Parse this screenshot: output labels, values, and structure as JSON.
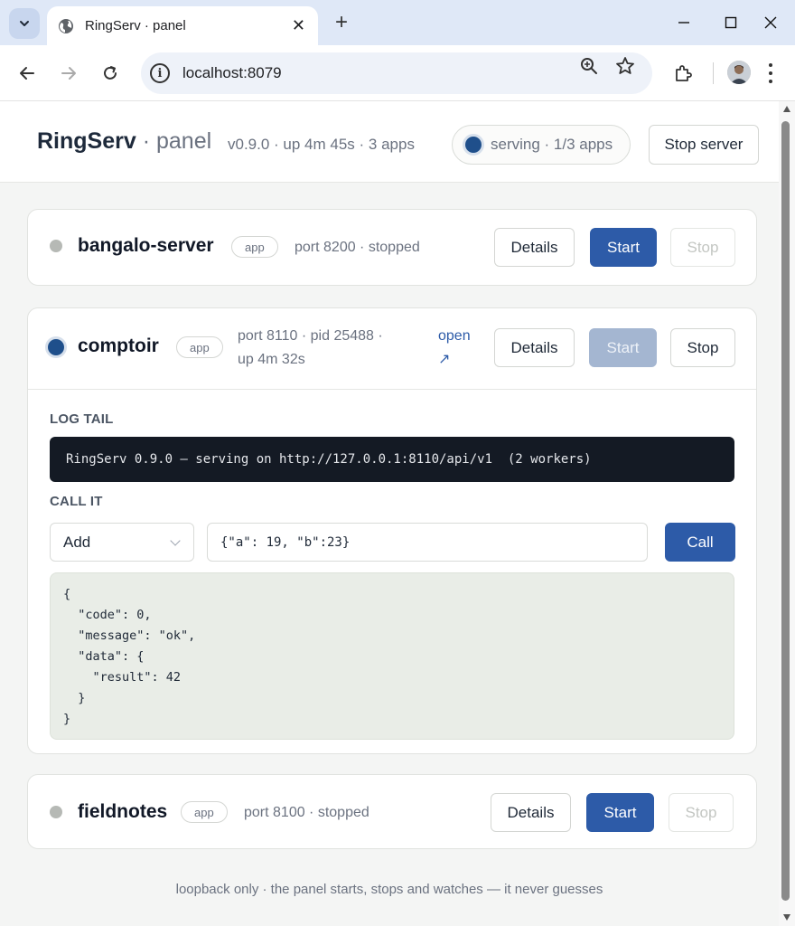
{
  "browser": {
    "tab_title": "RingServ · panel",
    "url": "localhost:8079"
  },
  "header": {
    "brand": "RingServ",
    "separator": "·",
    "subtitle": "panel",
    "meta": "v0.9.0 · up 4m 45s · 3 apps",
    "status": "serving · 1/3 apps",
    "stop_server_label": "Stop server"
  },
  "apps": [
    {
      "name": "bangalo-server",
      "tag": "app",
      "meta": "port 8200 · stopped",
      "running": false,
      "details_label": "Details",
      "start_label": "Start",
      "stop_label": "Stop"
    },
    {
      "name": "comptoir",
      "tag": "app",
      "meta_line1": "port 8110 · pid 25488 ·",
      "meta_line2": "up 4m 32s",
      "open_line1": "open",
      "open_line2": "↗",
      "running": true,
      "details_label": "Details",
      "start_label": "Start",
      "stop_label": "Stop",
      "log_label": "LOG TAIL",
      "log_line": "RingServ 0.9.0 — serving on http://127.0.0.1:8110/api/v1  (2 workers)",
      "call_label": "CALL IT",
      "method": "Add",
      "payload": "{\"a\": 19, \"b\":23}",
      "call_button": "Call",
      "response": "{\n  \"code\": 0,\n  \"message\": \"ok\",\n  \"data\": {\n    \"result\": 42\n  }\n}"
    },
    {
      "name": "fieldnotes",
      "tag": "app",
      "meta": "port 8100 · stopped",
      "running": false,
      "details_label": "Details",
      "start_label": "Start",
      "stop_label": "Stop"
    }
  ],
  "footer": "loopback only · the panel starts, stops and watches — it never guesses",
  "colors": {
    "primary": "#2d5ba8",
    "running_dot": "#1f4f8b",
    "stopped_dot": "#b6b9b5",
    "terminal_bg": "#141a24"
  }
}
